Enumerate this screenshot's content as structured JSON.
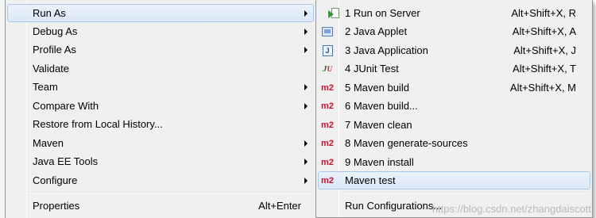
{
  "menu": {
    "items": [
      {
        "label": "Run As",
        "submenu": true,
        "selected": true
      },
      {
        "label": "Debug As",
        "submenu": true
      },
      {
        "label": "Profile As",
        "submenu": true
      },
      {
        "label": "Validate",
        "submenu": false
      },
      {
        "label": "Team",
        "submenu": true
      },
      {
        "label": "Compare With",
        "submenu": true
      },
      {
        "label": "Restore from Local History...",
        "submenu": false
      },
      {
        "label": "Maven",
        "submenu": true
      },
      {
        "label": "Java EE Tools",
        "submenu": true
      },
      {
        "label": "Configure",
        "submenu": true
      },
      {
        "label": "Properties",
        "shortcut": "Alt+Enter"
      }
    ]
  },
  "submenu": {
    "items": [
      {
        "label": "1 Run on Server",
        "shortcut": "Alt+Shift+X, R",
        "icon": "run-on-server-icon"
      },
      {
        "label": "2 Java Applet",
        "shortcut": "Alt+Shift+X, A",
        "icon": "java-applet-icon"
      },
      {
        "label": "3 Java Application",
        "shortcut": "Alt+Shift+X, J",
        "icon": "java-application-icon"
      },
      {
        "label": "4 JUnit Test",
        "shortcut": "Alt+Shift+X, T",
        "icon": "junit-icon"
      },
      {
        "label": "5 Maven build",
        "shortcut": "Alt+Shift+X, M",
        "icon": "maven-m2-icon"
      },
      {
        "label": "6 Maven build...",
        "icon": "maven-m2-icon"
      },
      {
        "label": "7 Maven clean",
        "icon": "maven-m2-icon"
      },
      {
        "label": "8 Maven generate-sources",
        "icon": "maven-m2-icon"
      },
      {
        "label": "9 Maven install",
        "icon": "maven-m2-icon"
      },
      {
        "label": "Maven test",
        "icon": "maven-m2-icon",
        "selected": true
      },
      {
        "label": "Run Configurations..."
      }
    ],
    "icon_text": {
      "m2": "m2",
      "java": "J",
      "junit_j": "J",
      "junit_u": "U"
    }
  },
  "watermark": "https://blog.csdn.net/zhangdaiscott",
  "colors": {
    "menu_bg": "#f0f0f0",
    "highlight": "#dbe8f7",
    "highlight_border": "#a8c8eb",
    "maven_red": "#c8102e"
  }
}
